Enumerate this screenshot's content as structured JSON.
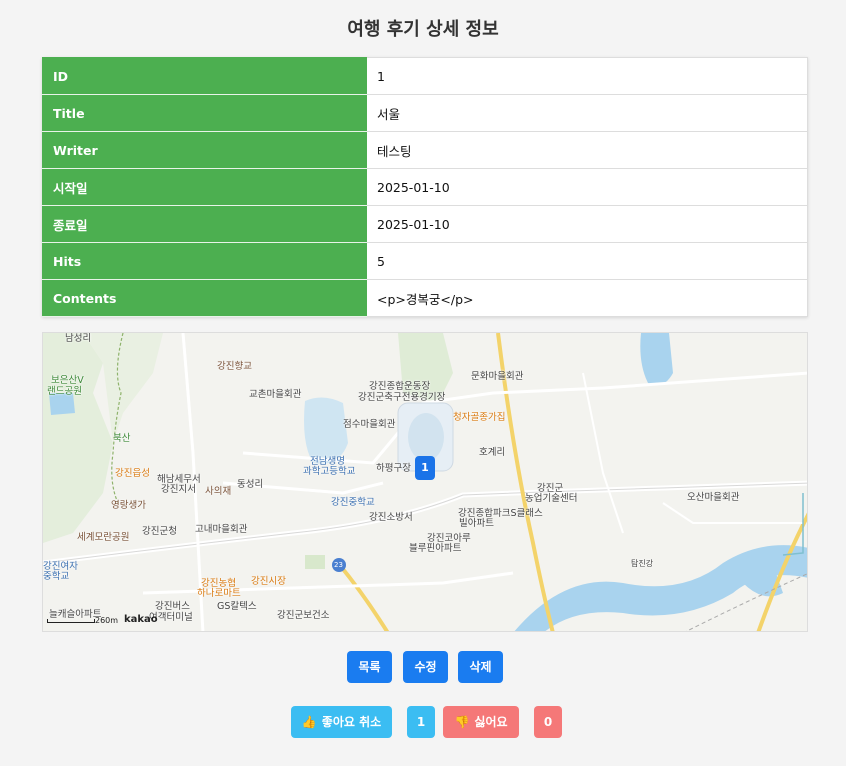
{
  "page": {
    "title": "여행 후기 상세 정보"
  },
  "details": {
    "rows": [
      {
        "label": "ID",
        "value": "1"
      },
      {
        "label": "Title",
        "value": "서울"
      },
      {
        "label": "Writer",
        "value": "테스팅"
      },
      {
        "label": "시작일",
        "value": "2025-01-10"
      },
      {
        "label": "종료일",
        "value": "2025-01-10"
      },
      {
        "label": "Hits",
        "value": "5"
      },
      {
        "label": "Contents",
        "value": "<p>경복궁</p>"
      }
    ]
  },
  "map": {
    "marker_label": "1",
    "scale_text": "260m",
    "logo_text": "kakao",
    "places": {
      "p1": "남성리",
      "p2": "강진향교",
      "p3": "교촌마을회관",
      "p4": "강진종합운동장",
      "p5": "강진군축구전용경기장",
      "p6": "문화마을회관",
      "p7": "보은산V",
      "p8": "랜드공원",
      "p9": "청자골종가집",
      "p10": "점수마을회관",
      "p11": "북산",
      "p12": "전남생명",
      "p13": "과학고등학교",
      "p14": "하평구장",
      "p15": "호계리",
      "p16": "강진읍성",
      "p17": "해남세무서",
      "p18": "강진지서",
      "p19": "사의재",
      "p20": "동성리",
      "p21": "영랑생가",
      "p22": "강진중학교",
      "p23": "강진소방서",
      "p24": "강진종합파크S클래스",
      "p25": "빌아파트",
      "p26": "강진군",
      "p27": "농업기술센터",
      "p28": "오산마을회관",
      "p29": "세계모란공원",
      "p30": "강진군청",
      "p31": "고내마을회관",
      "p32": "강진코아루",
      "p33": "블루핀아파트",
      "p34": "강진여자",
      "p35": "중학교",
      "p36": "강진농협",
      "p37": "하나로마트",
      "p38": "강진시장",
      "p39": "늘캐슬아파트",
      "p40": "강진버스",
      "p41": "여객터미널",
      "p42": "GS칼텍스",
      "p43": "강진군보건소",
      "p44": "23",
      "p45": "탐진강"
    }
  },
  "buttons": {
    "list": "목록",
    "edit": "수정",
    "delete": "삭제",
    "like_icon": "👍",
    "like_label": "좋아요 취소",
    "like_count": "1",
    "dislike_icon": "👎",
    "dislike_label": "싫어요",
    "dislike_count": "0"
  },
  "colors": {
    "label_bg": "#4caf50",
    "primary": "#1a7cf0",
    "like": "#3bbdf2",
    "dislike": "#f57878",
    "marker": "#1a73e8"
  }
}
